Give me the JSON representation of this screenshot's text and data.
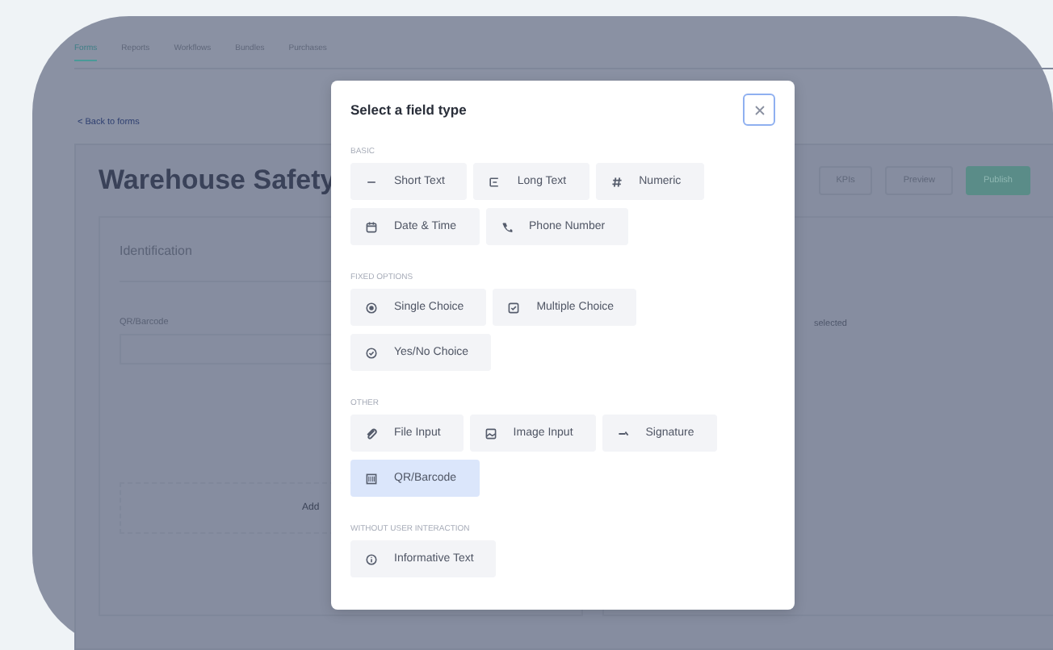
{
  "nav_tabs": [
    {
      "label": "Forms",
      "selected": true
    },
    {
      "label": "Reports",
      "selected": false
    },
    {
      "label": "Workflows",
      "selected": false
    },
    {
      "label": "Bundles",
      "selected": false
    },
    {
      "label": "Purchases",
      "selected": false
    }
  ],
  "back_link": "< Back to forms",
  "form_title": "Warehouse Safety",
  "header_buttons": [
    {
      "label": "KPIs",
      "kind": "plain"
    },
    {
      "label": "Preview",
      "kind": "preview"
    },
    {
      "label": "Publish",
      "kind": "publish"
    }
  ],
  "section": {
    "title": "Identification",
    "field_label": "QR/Barcode",
    "add_label": "Add"
  },
  "side_panel": {
    "text": "selected"
  },
  "modal": {
    "title": "Select a field type",
    "groups": [
      {
        "label": "BASIC",
        "items": [
          {
            "label": "Short Text",
            "kind": "short",
            "selected": false
          },
          {
            "label": "Long Text",
            "kind": "long",
            "selected": false
          },
          {
            "label": "Numeric",
            "kind": "numeric",
            "selected": false
          },
          {
            "label": "Date & Time",
            "kind": "datetime",
            "selected": false
          },
          {
            "label": "Phone Number",
            "kind": "phone",
            "selected": false
          }
        ]
      },
      {
        "label": "FIXED OPTIONS",
        "items": [
          {
            "label": "Single Choice",
            "kind": "single",
            "selected": false
          },
          {
            "label": "Multiple Choice",
            "kind": "multiple",
            "selected": false
          },
          {
            "label": "Yes/No Choice",
            "kind": "yesno",
            "selected": false
          }
        ]
      },
      {
        "label": "OTHER",
        "items": [
          {
            "label": "File Input",
            "kind": "file",
            "selected": false
          },
          {
            "label": "Image Input",
            "kind": "image",
            "selected": false
          },
          {
            "label": "Signature",
            "kind": "signature",
            "selected": false
          },
          {
            "label": "QR/Barcode",
            "kind": "barcode",
            "selected": true
          }
        ]
      },
      {
        "label": "WITHOUT USER INTERACTION",
        "items": [
          {
            "label": "Informative Text",
            "kind": "info",
            "selected": false
          }
        ]
      }
    ]
  }
}
